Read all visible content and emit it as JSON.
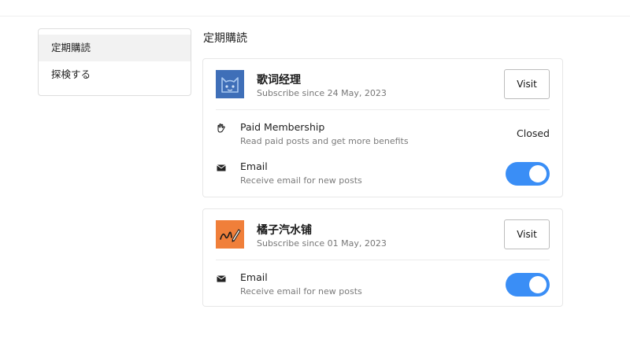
{
  "sidebar": {
    "items": [
      {
        "label": "定期購読",
        "active": true
      },
      {
        "label": "探検する",
        "active": false
      }
    ]
  },
  "page_title": "定期購読",
  "subscriptions": [
    {
      "name": "歌词经理",
      "since": "Subscribe since 24 May, 2023",
      "visit_label": "Visit",
      "avatar_icon": "cat-logo-icon",
      "avatar_color": "#3f6fb8",
      "rows": [
        {
          "icon": "hand-icon",
          "title": "Paid Membership",
          "desc": "Read paid posts and get more benefits",
          "status": "Closed"
        },
        {
          "icon": "envelope-icon",
          "title": "Email",
          "desc": "Receive email for new posts",
          "toggle_on": true
        }
      ]
    },
    {
      "name": "橘子汽水铺",
      "since": "Subscribe since 01 May, 2023",
      "visit_label": "Visit",
      "avatar_icon": "pencil-scribble-icon",
      "avatar_color": "#f07f3a",
      "rows": [
        {
          "icon": "envelope-icon",
          "title": "Email",
          "desc": "Receive email for new posts",
          "toggle_on": true
        }
      ]
    }
  ],
  "colors": {
    "toggle_on": "#3a8ef6",
    "active_bg": "#f2f2f2"
  }
}
